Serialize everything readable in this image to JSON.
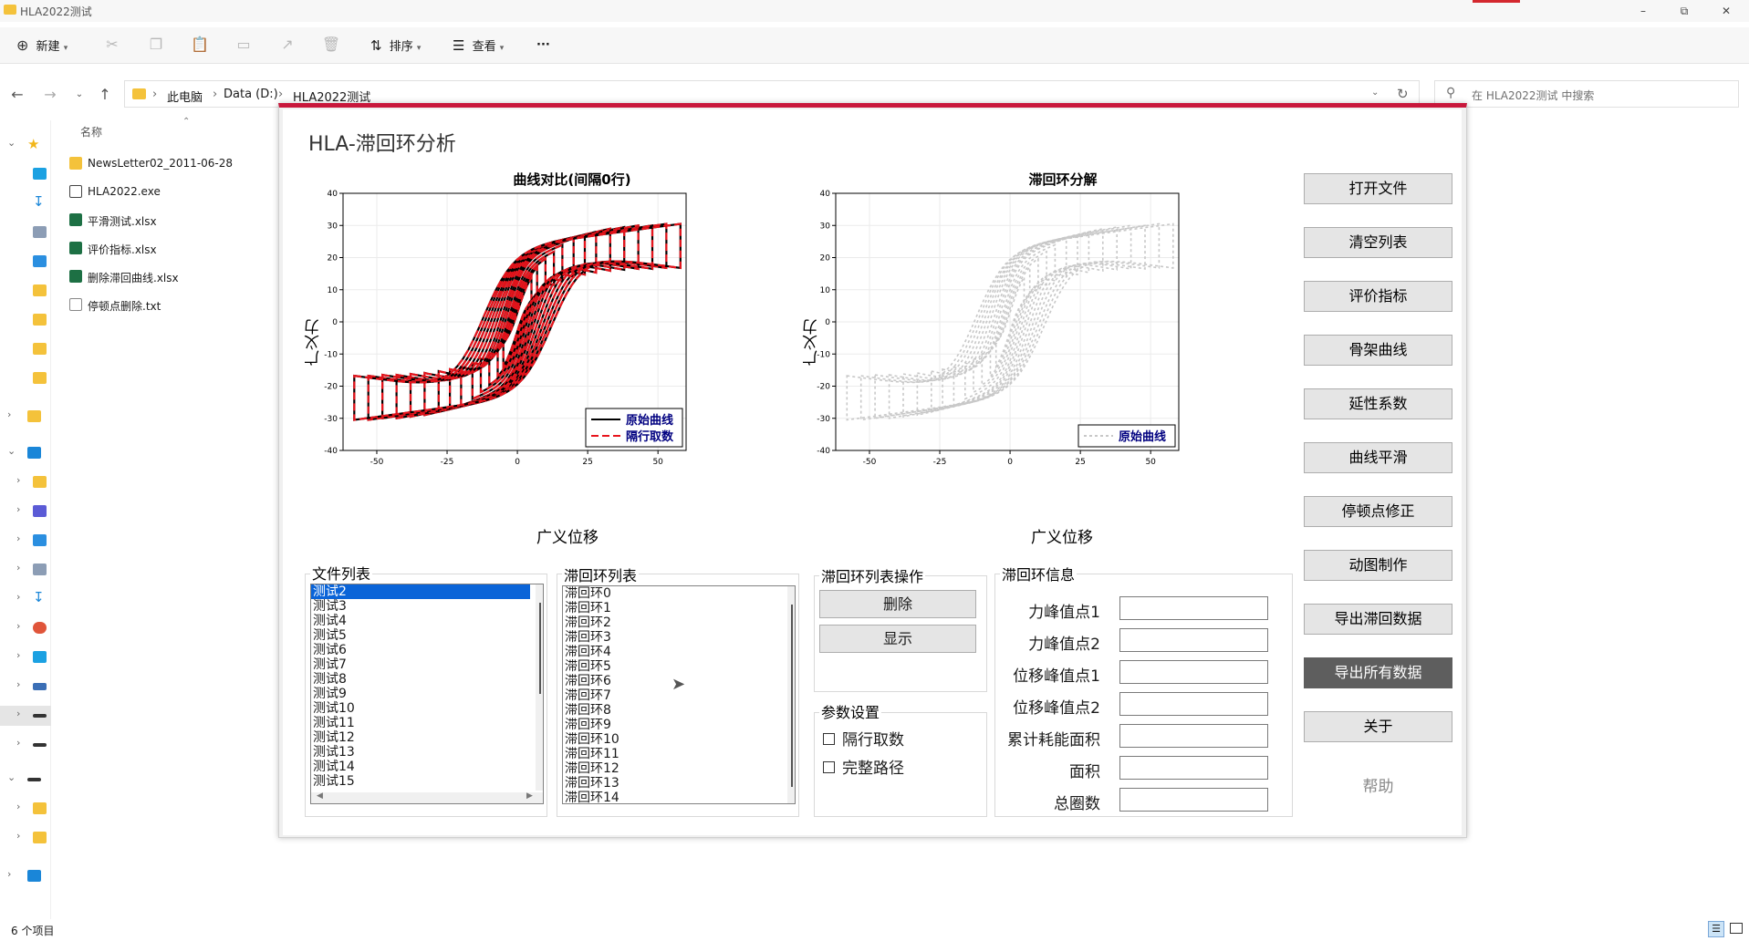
{
  "explorer": {
    "window_title": "HLA2022测试",
    "toolbar": {
      "new_label": "新建",
      "sort_label": "排序",
      "view_label": "查看",
      "more_label": "···"
    },
    "breadcrumb": [
      "此电脑",
      "Data (D:)",
      "HLA2022测试"
    ],
    "search_placeholder": "在 HLA2022测试 中搜索",
    "column_header": "名称",
    "files": [
      {
        "name": "NewsLetter02_2011-06-28",
        "icon": "folder-icon"
      },
      {
        "name": "HLA2022.exe",
        "icon": "exe-icon"
      },
      {
        "name": "平滑测试.xlsx",
        "icon": "excel-icon"
      },
      {
        "name": "评价指标.xlsx",
        "icon": "excel-icon"
      },
      {
        "name": "删除滞回曲线.xlsx",
        "icon": "excel-icon"
      },
      {
        "name": "停顿点删除.txt",
        "icon": "text-file-icon"
      }
    ],
    "status": "6 个项目"
  },
  "app": {
    "title": "HLA-滞回环分析",
    "chart1": {
      "title": "曲线对比(间隔0行)",
      "xlabel": "广义位移",
      "ylabel": "广义力",
      "legend": [
        "原始曲线",
        "隔行取数"
      ]
    },
    "chart2": {
      "title": "滞回环分解",
      "xlabel": "广义位移",
      "ylabel": "广义力",
      "legend": [
        "原始曲线"
      ]
    },
    "side_buttons": [
      "打开文件",
      "清空列表",
      "评价指标",
      "骨架曲线",
      "延性系数",
      "曲线平滑",
      "停顿点修正",
      "动图制作",
      "导出滞回数据",
      "导出所有数据",
      "关于"
    ],
    "help_label": "帮助",
    "file_list": {
      "label": "文件列表",
      "items": [
        "测试2",
        "测试3",
        "测试4",
        "测试5",
        "测试6",
        "测试7",
        "测试8",
        "测试9",
        "测试10",
        "测试11",
        "测试12",
        "测试13",
        "测试14",
        "测试15"
      ],
      "selected_index": 0
    },
    "loop_list": {
      "label": "滞回环列表",
      "items": [
        "滞回环0",
        "滞回环1",
        "滞回环2",
        "滞回环3",
        "滞回环4",
        "滞回环5",
        "滞回环6",
        "滞回环7",
        "滞回环8",
        "滞回环9",
        "滞回环10",
        "滞回环11",
        "滞回环12",
        "滞回环13",
        "滞回环14"
      ]
    },
    "loop_ops": {
      "label": "滞回环列表操作",
      "delete_label": "删除",
      "show_label": "显示"
    },
    "params": {
      "label": "参数设置",
      "skip_rows_label": "隔行取数",
      "full_path_label": "完整路径",
      "skip_rows_checked": false,
      "full_path_checked": false
    },
    "info": {
      "label": "滞回环信息",
      "fields": [
        "力峰值点1",
        "力峰值点2",
        "位移峰值点1",
        "位移峰值点2",
        "累计耗能面积",
        "面积",
        "总圈数"
      ]
    }
  },
  "chart_data": [
    {
      "type": "line",
      "title": "曲线对比(间隔0行)",
      "xlabel": "广义位移",
      "ylabel": "广义力",
      "xlim": [
        -62,
        60
      ],
      "ylim": [
        -40,
        40
      ],
      "xticks": [
        -50,
        -25,
        0,
        25,
        50
      ],
      "yticks": [
        -40,
        -30,
        -20,
        -10,
        0,
        10,
        20,
        30,
        40
      ],
      "grid": true,
      "legend_position": "bottom-right",
      "series": [
        {
          "name": "原始曲线",
          "color": "#000000",
          "style": "solid"
        },
        {
          "name": "隔行取数",
          "color": "#e8141c",
          "style": "dashed"
        }
      ],
      "loop_amplitudes": [
        5,
        7,
        10,
        13,
        16,
        20,
        24,
        28,
        33,
        38,
        43,
        48,
        53,
        58
      ],
      "loop_peak_forces": [
        16,
        18,
        20,
        22,
        24,
        26,
        27,
        28,
        29,
        29.5,
        30,
        30,
        30.5,
        30.5
      ]
    },
    {
      "type": "line",
      "title": "滞回环分解",
      "xlabel": "广义位移",
      "ylabel": "广义力",
      "xlim": [
        -62,
        60
      ],
      "ylim": [
        -40,
        40
      ],
      "xticks": [
        -50,
        -25,
        0,
        25,
        50
      ],
      "yticks": [
        -40,
        -30,
        -20,
        -10,
        0,
        10,
        20,
        30,
        40
      ],
      "grid": true,
      "legend_position": "bottom-right",
      "series": [
        {
          "name": "原始曲线",
          "color": "#c8c8c8",
          "style": "dotted"
        }
      ],
      "loop_amplitudes": [
        5,
        7,
        10,
        13,
        16,
        20,
        24,
        28,
        33,
        38,
        43,
        48,
        53,
        58
      ],
      "loop_peak_forces": [
        16,
        18,
        20,
        22,
        24,
        26,
        27,
        28,
        29,
        29.5,
        30,
        30,
        30.5,
        30.5
      ]
    }
  ]
}
